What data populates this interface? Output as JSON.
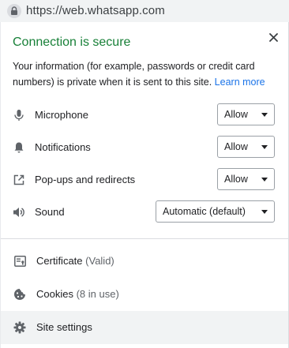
{
  "address_bar": {
    "url": "https://web.whatsapp.com"
  },
  "panel": {
    "title": "Connection is secure",
    "description": "Your information (for example, passwords or credit card numbers) is private when it is sent to this site.",
    "learn_more": "Learn more",
    "permissions": [
      {
        "label": "Microphone",
        "value": "Allow",
        "icon": "microphone-icon"
      },
      {
        "label": "Notifications",
        "value": "Allow",
        "icon": "bell-icon"
      },
      {
        "label": "Pop-ups and redirects",
        "value": "Allow",
        "icon": "external-link-icon"
      },
      {
        "label": "Sound",
        "value": "Automatic (default)",
        "icon": "speaker-icon"
      }
    ],
    "links": [
      {
        "label": "Certificate",
        "sub": "(Valid)",
        "icon": "certificate-icon"
      },
      {
        "label": "Cookies",
        "sub": "(8 in use)",
        "icon": "cookie-icon"
      },
      {
        "label": "Site settings",
        "sub": "",
        "icon": "gear-icon"
      }
    ]
  },
  "colors": {
    "secure_green": "#188038",
    "link_blue": "#1a73e8",
    "icon_gray": "#5f6368"
  }
}
